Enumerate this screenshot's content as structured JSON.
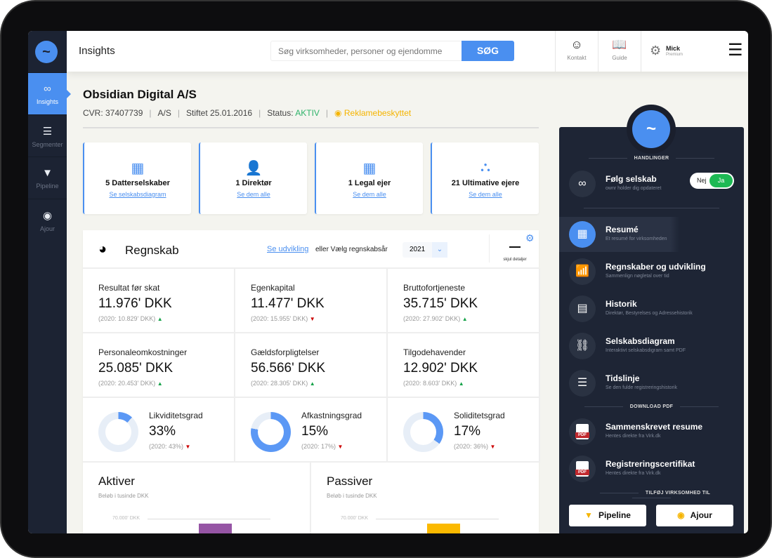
{
  "sidebar": {
    "items": [
      {
        "label": "Insights",
        "icon": "binoculars-icon",
        "active": true
      },
      {
        "label": "Segmenter",
        "icon": "sliders-icon"
      },
      {
        "label": "Pipeline",
        "icon": "funnel-icon"
      },
      {
        "label": "Ajour",
        "icon": "eye-badge-icon"
      }
    ]
  },
  "header": {
    "title": "Insights",
    "search_placeholder": "Søg virksomheder, personer og ejendomme",
    "search_button": "SØG",
    "contact": "Kontakt",
    "guide": "Guide",
    "user_name": "Mick",
    "user_plan": "Premium"
  },
  "company": {
    "name": "Obsidian Digital A/S",
    "cvr": "CVR: 37407739",
    "type": "A/S",
    "founded": "Stiftet 25.01.2016",
    "status_label": "Status:",
    "status_value": "AKTIV",
    "protected": "Reklamebeskyttet"
  },
  "cards": [
    {
      "label": "5 Datterselskaber",
      "link": "Se selskabsdiagram",
      "icon": "building-icon"
    },
    {
      "label": "1 Direktør",
      "link": "Se dem alle",
      "icon": "person-icon"
    },
    {
      "label": "1 Legal ejer",
      "link": "Se dem alle",
      "icon": "building-people-icon"
    },
    {
      "label": "21 Ultimative ejere",
      "link": "Se dem alle",
      "icon": "org-people-icon"
    }
  ],
  "regnskab": {
    "title": "Regnskab",
    "link": "Se udvikling",
    "or_text": "eller Vælg regnskabsår",
    "year": "2021",
    "hide_details": "skjul detaljer",
    "metrics": [
      {
        "title": "Resultat før skat",
        "value": "11.976' DKK",
        "prev": "(2020: 10.829' DKK)",
        "trend": "up"
      },
      {
        "title": "Egenkapital",
        "value": "11.477' DKK",
        "prev": "(2020: 15.955' DKK)",
        "trend": "down"
      },
      {
        "title": "Bruttofortjeneste",
        "value": "35.715' DKK",
        "prev": "(2020: 27.902' DKK)",
        "trend": "up"
      },
      {
        "title": "Personaleomkostninger",
        "value": "25.085' DKK",
        "prev": "(2020: 20.453' DKK)",
        "trend": "up"
      },
      {
        "title": "Gældsforpligtelser",
        "value": "56.566' DKK",
        "prev": "(2020: 28.305' DKK)",
        "trend": "up"
      },
      {
        "title": "Tilgodehavender",
        "value": "12.902' DKK",
        "prev": "(2020: 8.603' DKK)",
        "trend": "up"
      }
    ],
    "ratios": [
      {
        "title": "Likviditetsgrad",
        "value": "33%",
        "prev": "(2020: 43%)",
        "trend": "down",
        "ring_fill_pct": 12
      },
      {
        "title": "Afkastningsgrad",
        "value": "15%",
        "prev": "(2020: 17%)",
        "trend": "down",
        "ring_fill_pct": 78
      },
      {
        "title": "Soliditetsgrad",
        "value": "17%",
        "prev": "(2020: 36%)",
        "trend": "down",
        "ring_fill_pct": 35
      }
    ],
    "charts": [
      {
        "title": "Aktiver",
        "subtitle": "Beløb i tusinde DKK",
        "tick": "70.000' DKK",
        "color": "#9655a5"
      },
      {
        "title": "Passiver",
        "subtitle": "Beløb i tusinde DKK",
        "tick": "70.000' DKK",
        "color": "#fbb900"
      }
    ]
  },
  "panel": {
    "actions_heading": "HANDLINGER",
    "follow": {
      "title": "Følg selskab",
      "sub": "ownr holder dig opdateret",
      "off": "Nej",
      "on": "Ja",
      "value": "Ja"
    },
    "nav": [
      {
        "title": "Resumé",
        "sub": "Et resumé for virksomheden",
        "icon": "building-icon",
        "active": true
      },
      {
        "title": "Regnskaber og udvikling",
        "sub": "Sammenlign nøgletal over tid",
        "icon": "chart-icon"
      },
      {
        "title": "Historik",
        "sub": "Direktør, Bestyrelses og Adressehistorik",
        "icon": "document-icon"
      },
      {
        "title": "Selskabsdiagram",
        "sub": "Interaktivt selskabsdigram samt PDF",
        "icon": "hierarchy-icon"
      },
      {
        "title": "Tidslinje",
        "sub": "Se den fulde registreringshistorik",
        "icon": "list-icon"
      }
    ],
    "download_heading": "DOWNLOAD PDF",
    "downloads": [
      {
        "title": "Sammenskrevet resume",
        "sub": "Hentes direkte fra Virk.dk"
      },
      {
        "title": "Registreringscertifikat",
        "sub": "Hentes direkte fra Virk.dk"
      }
    ],
    "add_heading": "TILFØJ VIRKSOMHED TIL",
    "pipeline": "Pipeline",
    "ajour": "Ajour"
  },
  "colors": {
    "accent": "#4a8ff0",
    "sidebar": "#1c2333",
    "panel": "#1e2535",
    "active_green": "#1db954",
    "warning": "#f5b400",
    "status_green": "#2fb36a"
  }
}
